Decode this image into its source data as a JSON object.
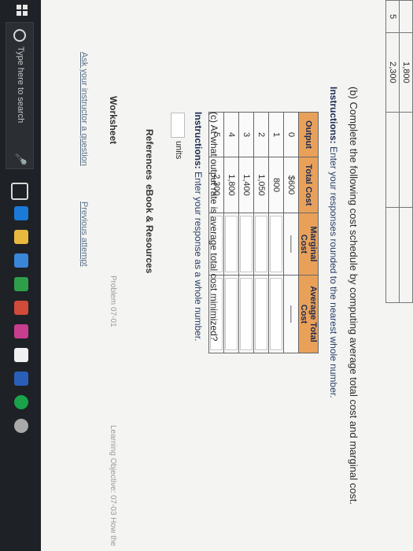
{
  "previous_table": {
    "rows": [
      {
        "output": "",
        "value": "1,800"
      },
      {
        "output": "5",
        "value": "2,300"
      }
    ]
  },
  "part_b": {
    "prompt": "(b) Complete the following cost schedule by computing average total cost and marginal cost.",
    "instructions_label": "Instructions:",
    "instructions_text": "Enter your responses rounded to the nearest whole number."
  },
  "cost_table": {
    "headers": {
      "output": "Output",
      "total_cost": "Total Cost",
      "marginal_cost": "Marginal Cost",
      "average_total_cost": "Average Total Cost"
    },
    "rows": [
      {
        "output": "0",
        "total_cost": "$600",
        "mc_fixed": "——",
        "atc_fixed": "——"
      },
      {
        "output": "1",
        "total_cost": "800"
      },
      {
        "output": "2",
        "total_cost": "1,050"
      },
      {
        "output": "3",
        "total_cost": "1,400"
      },
      {
        "output": "4",
        "total_cost": "1,800"
      },
      {
        "output": "5",
        "total_cost": "2,300"
      }
    ]
  },
  "part_c": {
    "prompt": "(c) At what output rate is average total cost minimized?",
    "instructions_label": "Instructions:",
    "instructions_text": "Enter your response as a whole number.",
    "units_value": "",
    "units_label": "units"
  },
  "references": {
    "label": "References",
    "ebook_label": "eBook & Resources"
  },
  "worksheet": {
    "label": "Worksheet",
    "problem_id": "Problem 07-01",
    "learning_objective": "Learning Objective: 07-03 How the"
  },
  "links": {
    "ask": "Ask your instructor a question",
    "previous": "Previous attempt"
  },
  "taskbar": {
    "search_placeholder": "Type here to search"
  }
}
